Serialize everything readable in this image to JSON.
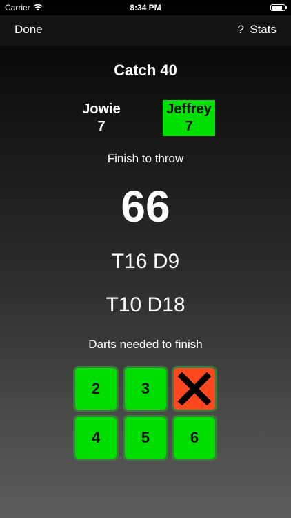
{
  "status_bar": {
    "carrier": "Carrier",
    "time": "8:34 PM"
  },
  "nav": {
    "done_label": "Done",
    "help_label": "?",
    "stats_label": "Stats"
  },
  "game": {
    "title": "Catch 40",
    "players": [
      {
        "name": "Jowie",
        "score": "7",
        "active": false
      },
      {
        "name": "Jeffrey",
        "score": "7",
        "active": true
      }
    ],
    "finish_label": "Finish to throw",
    "remaining": "66",
    "checkouts": [
      "T16 D9",
      "T10 D18"
    ],
    "darts_label": "Darts needed to finish",
    "dart_buttons": [
      {
        "label": "2",
        "state": "enabled"
      },
      {
        "label": "3",
        "state": "enabled"
      },
      {
        "label": "",
        "state": "disabled",
        "icon": "x-icon"
      },
      {
        "label": "4",
        "state": "enabled"
      },
      {
        "label": "5",
        "state": "enabled"
      },
      {
        "label": "6",
        "state": "enabled"
      }
    ]
  },
  "colors": {
    "active_green": "#00e000",
    "button_green": "#00dd00",
    "disabled_red": "#ff4820"
  }
}
